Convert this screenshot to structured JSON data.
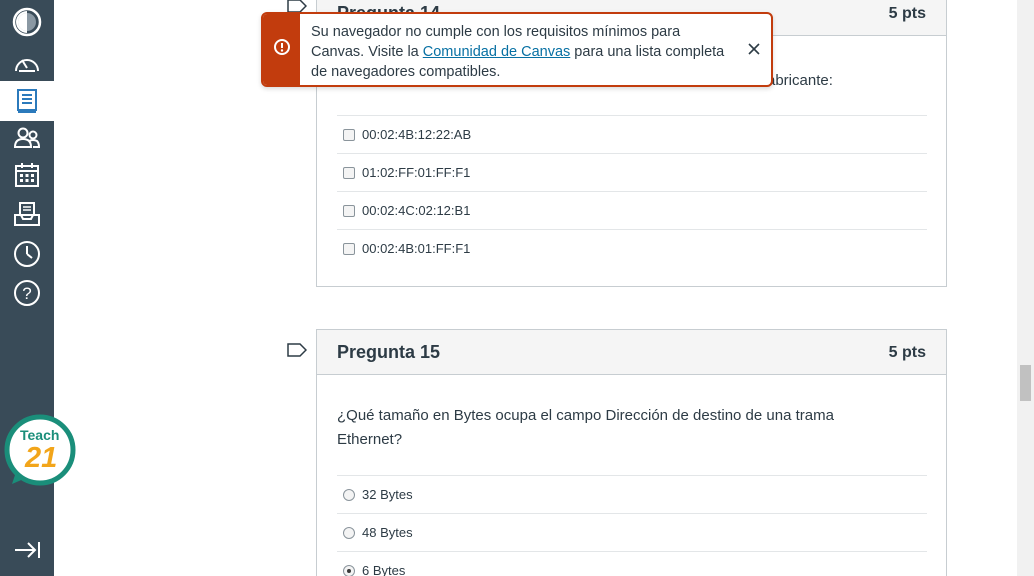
{
  "alert": {
    "text_before": "Su navegador no cumple con los requisitos mínimos para Canvas. Visite la ",
    "link_text": "Comunidad de Canvas",
    "text_after": " para una lista completa de navegadores compatibles.",
    "icon": "exclamation-icon",
    "close_icon": "close-icon"
  },
  "nav": {
    "items": [
      {
        "icon": "account-icon"
      },
      {
        "icon": "dashboard-icon"
      },
      {
        "icon": "courses-icon"
      },
      {
        "icon": "groups-icon"
      },
      {
        "icon": "calendar-icon"
      },
      {
        "icon": "inbox-icon"
      },
      {
        "icon": "history-icon"
      },
      {
        "icon": "help-icon"
      }
    ],
    "logo_top": "Teach",
    "logo_bottom": "21",
    "collapse_icon": "collapse-nav-icon"
  },
  "questions": [
    {
      "title": "Pregunta 14",
      "points": "5 pts",
      "text_fragment": "abricante:",
      "answers": [
        "00:02:4B:12:22:AB",
        "01:02:FF:01:FF:F1",
        "00:02:4C:02:12:B1",
        "00:02:4B:01:FF:F1"
      ]
    },
    {
      "title": "Pregunta 15",
      "points": "5 pts",
      "text": "¿Qué tamaño en Bytes ocupa el campo Dirección de destino de una trama Ethernet?",
      "answers": [
        "32 Bytes",
        "48 Bytes",
        "6 Bytes"
      ],
      "selected": "6 Bytes"
    }
  ],
  "colors": {
    "nav_bg": "#394b58",
    "alert_accent": "#c23c0d",
    "link": "#0770a3",
    "teach_green": "#1a8e7a"
  }
}
